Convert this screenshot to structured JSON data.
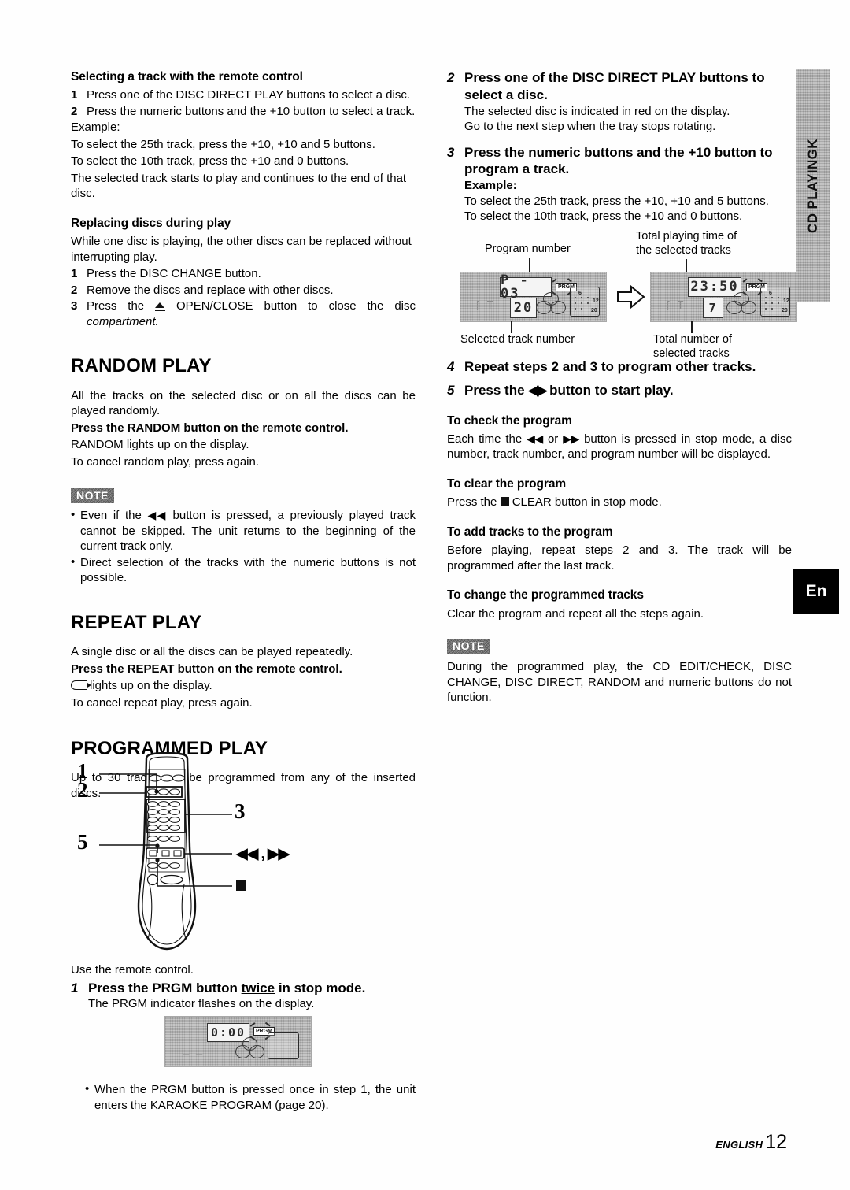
{
  "page": {
    "footer_label": "ENGLISH",
    "footer_page": "12",
    "side_tab": "CD PLAYINGK",
    "lang_box": "En"
  },
  "left": {
    "sec_select_track": {
      "heading": "Selecting a track with the remote control",
      "items": [
        {
          "num": "1",
          "text": "Press one of the DISC DIRECT PLAY buttons to select a disc."
        },
        {
          "num": "2",
          "text": "Press the numeric buttons and the +10 button to select a track."
        }
      ],
      "example_label": "Example:",
      "example_lines": [
        "To select the 25th track, press the +10, +10 and 5 buttons.",
        "To select the 10th track, press the +10 and 0 buttons.",
        "The selected track starts to play and continues to the end of that disc."
      ]
    },
    "sec_replacing": {
      "heading": "Replacing discs during play",
      "intro": "While one disc is playing, the other discs can be replaced without interrupting  play.",
      "items": [
        {
          "num": "1",
          "text": "Press the DISC CHANGE button."
        },
        {
          "num": "2",
          "text": "Remove the discs and replace with other discs."
        },
        {
          "num": "3",
          "text_before": "Press the ",
          "text_after": " OPEN/CLOSE button to close the disc ",
          "italic_tail": "compartment."
        }
      ]
    },
    "sec_random": {
      "heading": "RANDOM PLAY",
      "intro": "All the tracks on the selected disc or on all the discs can be played randomly.",
      "bold_line": "Press the RANDOM button on the remote control.",
      "line2": "RANDOM lights up on the display.",
      "line3": "To cancel random play, press again.",
      "note_label": "NOTE",
      "notes_before": "Even if the ",
      "notes_after": " button is pressed, a previously played track cannot be skipped. The unit returns to the beginning of the current track only.",
      "note2": "Direct selection of the tracks with the numeric buttons is not possible."
    },
    "sec_repeat": {
      "heading": "REPEAT PLAY",
      "intro": "A single disc or all the discs can be played repeatedly.",
      "bold_line": "Press the REPEAT button on the remote control.",
      "glyph_line": "lights up on the display.",
      "line3": "To cancel repeat play, press again."
    },
    "sec_programmed": {
      "heading": "PROGRAMMED PLAY",
      "intro": "Up to 30 tracks can be programmed from any of the inserted discs.",
      "remote_callouts": [
        "1",
        "2",
        "3",
        "5"
      ],
      "remote_label_ffrw": "◀◀ , ▶▶",
      "use_remote": "Use the remote control.",
      "step1_num": "1",
      "step1_title_a": "Press the PRGM button ",
      "step1_title_u": "twice",
      "step1_title_b": " in stop mode.",
      "step1_sub": "The PRGM indicator flashes on the display.",
      "bullet": "When the PRGM button is pressed once in step 1, the unit enters the KARAOKE PROGRAM (page 20).",
      "lcd_prgm": {
        "time": "0:00",
        "prgm_tag": "PRGM",
        "faint": " "
      }
    }
  },
  "right": {
    "step2": {
      "num": "2",
      "title": "Press one of the DISC DIRECT PLAY buttons to select a disc.",
      "lines": [
        "The selected disc is indicated in red on the display.",
        "Go to the next step when the tray stops rotating."
      ]
    },
    "step3": {
      "num": "3",
      "title": "Press the numeric buttons and the +10 button to program a track.",
      "example_label": "Example:",
      "lines": [
        "To select the 25th track, press the +10, +10 and 5 buttons.",
        "To select the 10th track, press the +10 and 0 buttons."
      ]
    },
    "diagram": {
      "label_program_number": "Program number",
      "label_selected_track_number": "Selected track number",
      "label_total_time": "Total playing time of the selected tracks",
      "label_total_number": "Total number of selected tracks",
      "lcd_left": {
        "main": "P - 03",
        "track": "20",
        "prgm_tag": "PRGM",
        "disc_marks": [
          "6",
          "12",
          "20"
        ]
      },
      "lcd_right": {
        "main": "23:50",
        "track": "7",
        "prgm_tag": "PRGM",
        "disc_marks": [
          "6",
          "12",
          "20"
        ]
      }
    },
    "step4": {
      "num": "4",
      "title": "Repeat steps 2 and 3 to program other tracks."
    },
    "step5": {
      "num": "5",
      "title_a": "Press the ",
      "title_b": " button to start play."
    },
    "check": {
      "heading": "To check the program",
      "text_a": "Each time the ",
      "text_mid": " or ",
      "text_b": " button is pressed in stop mode, a disc number, track number, and program number will be displayed."
    },
    "clear": {
      "heading": "To clear the program",
      "text_a": "Press the ",
      "text_b": " CLEAR button in stop mode."
    },
    "add": {
      "heading": "To add tracks to the program",
      "text": "Before playing, repeat steps 2 and 3. The track will be programmed after the last track."
    },
    "change": {
      "heading": "To change the programmed tracks",
      "text": "Clear the program and repeat all the steps again."
    },
    "note": {
      "label": "NOTE",
      "text": "During the programmed play, the CD EDIT/CHECK, DISC CHANGE, DISC DIRECT, RANDOM and numeric buttons do not function."
    }
  }
}
